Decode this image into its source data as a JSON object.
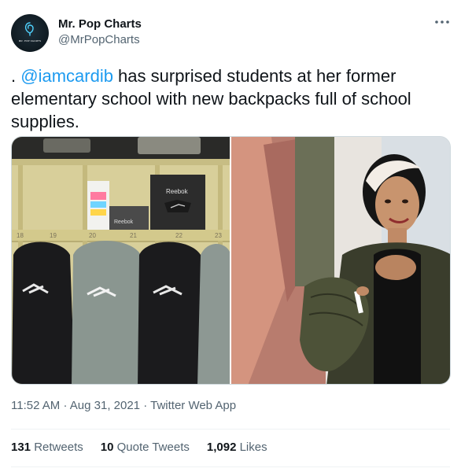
{
  "user": {
    "name": "Mr. Pop Charts",
    "handle": "@MrPopCharts",
    "avatar_text": "MR. POP CHARTS"
  },
  "tweet": {
    "prefix": ". ",
    "mention": "@iamcardib",
    "body": " has surprised students at her former elementary school with new backpacks full of school supplies."
  },
  "media": {
    "left_image": {
      "brand_box_label": "Reebok",
      "brand_box_small_label": "Reebok",
      "hook_numbers": [
        "18",
        "19",
        "20",
        "21",
        "22",
        "23"
      ]
    }
  },
  "meta": {
    "time": "11:52 AM",
    "date": "Aug 31, 2021",
    "source": "Twitter Web App"
  },
  "stats": {
    "retweets_count": "131",
    "retweets_label": "Retweets",
    "quotes_count": "10",
    "quotes_label": "Quote Tweets",
    "likes_count": "1,092",
    "likes_label": "Likes"
  },
  "icons": {
    "more": "more-horizontal-icon"
  }
}
